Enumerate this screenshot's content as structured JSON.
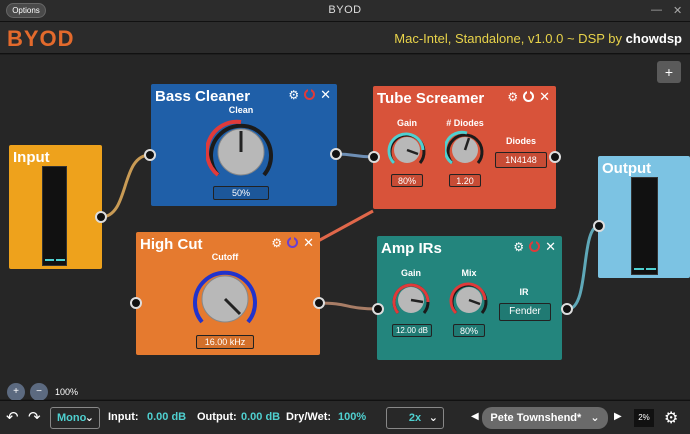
{
  "titlebar": {
    "options_label": "Options",
    "title": "BYOD",
    "minimize": "—",
    "close": "✕"
  },
  "header": {
    "logo": "BYOD",
    "info_prefix": "Mac-Intel, Standalone, v1.0.0 ~ DSP by",
    "info_author": "chowdsp"
  },
  "board": {
    "add_label": "+"
  },
  "modules": {
    "input": {
      "title": "Input"
    },
    "output": {
      "title": "Output"
    },
    "bass_cleaner": {
      "title": "Bass Cleaner",
      "param_label": "Clean",
      "param_value": "50%"
    },
    "tube_screamer": {
      "title": "Tube Screamer",
      "gain_label": "Gain",
      "gain_value": "80%",
      "diodes_label": "# Diodes",
      "diodes_value": "1.20",
      "diode_type_label": "Diodes",
      "diode_type_value": "1N4148"
    },
    "high_cut": {
      "title": "High Cut",
      "cutoff_label": "Cutoff",
      "cutoff_value": "16.00 kHz"
    },
    "amp_irs": {
      "title": "Amp IRs",
      "gain_label": "Gain",
      "gain_value": "12.00 dB",
      "mix_label": "Mix",
      "mix_value": "80%",
      "ir_label": "IR",
      "ir_value": "Fender"
    }
  },
  "zoom": {
    "zoom_in": "+",
    "zoom_out": "−",
    "level": "100%"
  },
  "footer": {
    "mode": "Mono",
    "input_label": "Input:",
    "input_value": "0.00 dB",
    "output_label": "Output:",
    "output_value": "0.00 dB",
    "drywet_label": "Dry/Wet:",
    "drywet_value": "100%",
    "oversampling": "2x",
    "preset": "Pete Townshend*",
    "cpu": "2%"
  },
  "colors": {
    "accent_cyan": "#4fd0d0",
    "header_yellow": "#e8d34a",
    "logo_orange": "#e36a2c",
    "bass_cleaner": "#1f5fa8",
    "tube_screamer": "#d8533a",
    "high_cut": "#e57a2f",
    "amp_irs": "#23857d",
    "input": "#eea21c",
    "output": "#7cc3e3"
  }
}
